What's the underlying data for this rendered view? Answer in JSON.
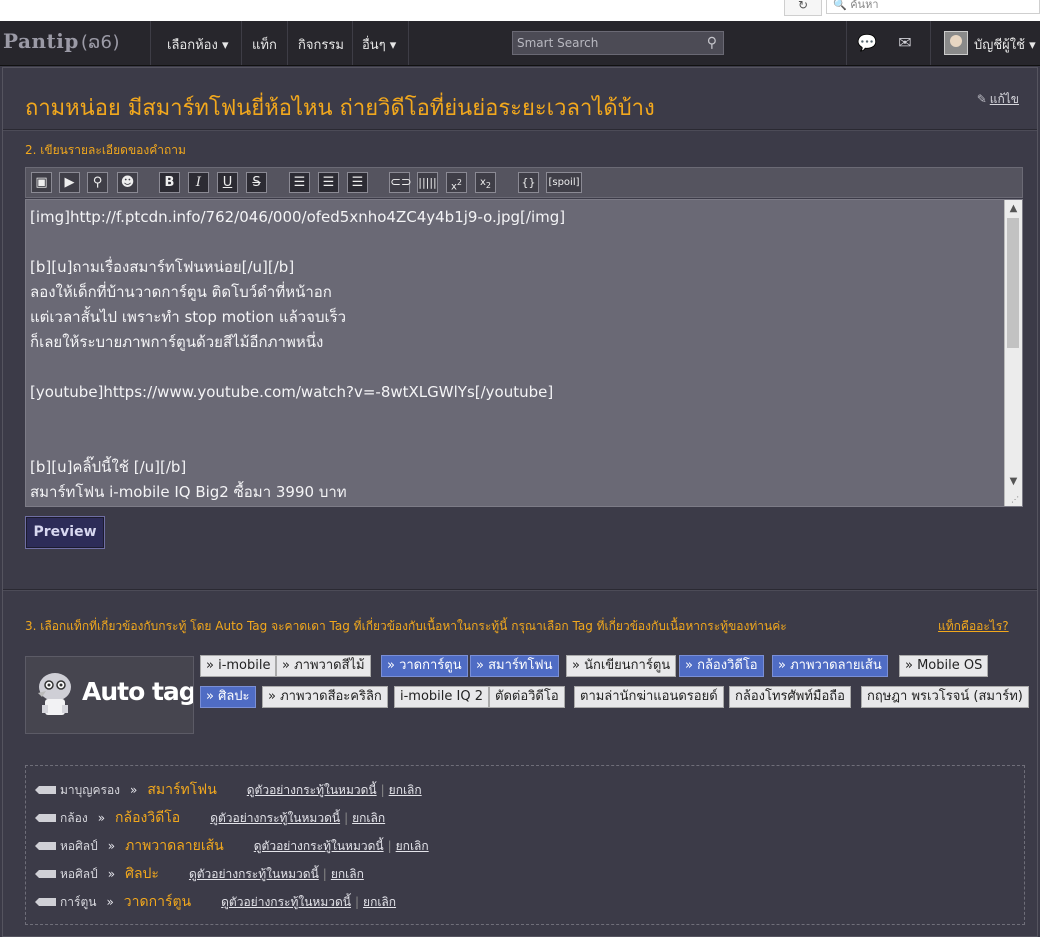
{
  "browser": {
    "search_placeholder": "ค้นหา",
    "refresh": "↻"
  },
  "navbar": {
    "logo_main": "Pantip",
    "logo_sub": "(ລ6)",
    "items": [
      "เลือกห้อง ▾",
      "แท็ก",
      "กิจกรรม",
      "อื่นๆ ▾"
    ],
    "search_placeholder": "Smart Search",
    "account": "บัญชีผู้ใช้ ▾"
  },
  "post": {
    "title": "ถามหน่อย มีสมาร์ทโฟนยี่ห้อไหน ถ่ายวิดีโอที่ย่นย่อระยะเวลาได้บ้าง",
    "edit": "แก้ไข"
  },
  "section2": {
    "heading": "2. เขียนรายละเอียดของคำถาม",
    "toolbar": {
      "bold": "B",
      "italic": "I",
      "underline": "U",
      "strike": "S",
      "superscript": "x2",
      "subscript": "x2",
      "code": "{}",
      "spoil": "[spoil]"
    },
    "editor_lines": [
      "[img]http://f.ptcdn.info/762/046/000/ofed5xnho4ZC4y4b1j9-o.jpg[/img]",
      "",
      "[b][u]ถามเรื่องสมาร์ทโฟนหน่อย[/u][/b]",
      "ลองให้เด็กที่บ้านวาดการ์ตูน ติดโบว์ดำที่หน้าอก",
      "แต่เวลาสั้นไป เพราะทำ stop motion แล้วจบเร็ว",
      "ก็เลยให้ระบายภาพการ์ตูนด้วยสีไม้อีกภาพหนึ่ง",
      "",
      "[youtube]https://www.youtube.com/watch?v=-8wtXLGWlYs[/youtube]",
      "",
      "",
      "[b][u]คลิ๊ปนี้ใช้ [/u][/b]",
      "สมาร์ทโฟน i-mobile IQ Big2 ซื้อมา 3990 บาท"
    ],
    "preview": "Preview"
  },
  "section3": {
    "heading": "3. เลือกแท็กที่เกี่ยวข้องกับกระทู้ โดย Auto Tag จะคาดเดา Tag ที่เกี่ยวข้องกับเนื้อหาในกระทู้นี้ กรุณาเลือก Tag ที่เกี่ยวข้องกับเนื้อหากระทู้ของท่านค่ะ",
    "what_is_tag": "แท็กคืออะไร?",
    "autotag_label": "Auto tag",
    "tags_row1": [
      {
        "label": "» i-mobile",
        "selected": false
      },
      {
        "label": "» ภาพวาดสีไม้",
        "selected": false
      },
      {
        "label": "» วาดการ์ตูน",
        "selected": true
      },
      {
        "label": "» สมาร์ทโฟน",
        "selected": true
      },
      {
        "label": "» นักเขียนการ์ตูน",
        "selected": false
      },
      {
        "label": "» กล้องวิดีโอ",
        "selected": true
      },
      {
        "label": "» ภาพวาดลายเส้น",
        "selected": true
      },
      {
        "label": "» Mobile OS",
        "selected": false
      }
    ],
    "tags_row2": [
      {
        "label": "» ศิลปะ",
        "selected": true
      },
      {
        "label": "» ภาพวาดสีอะคริลิก",
        "selected": false
      },
      {
        "label": "i-mobile IQ 2",
        "selected": false
      },
      {
        "label": "ตัดต่อวิดีโอ",
        "selected": false
      },
      {
        "label": "ตามล่านักฆ่าแอนดรอยด์",
        "selected": false
      },
      {
        "label": "กล้องโทรศัพท์มือถือ",
        "selected": false
      },
      {
        "label": "กฤษฎา พรเวโรจน์ (สมาร์ท)",
        "selected": false
      }
    ],
    "selected": [
      {
        "room": "มาบุญครอง",
        "tag": "สมาร์ทโฟน"
      },
      {
        "room": "กล้อง",
        "tag": "กล้องวิดีโอ"
      },
      {
        "room": "หอศิลป์",
        "tag": "ภาพวาดลายเส้น"
      },
      {
        "room": "หอศิลป์",
        "tag": "ศิลปะ"
      },
      {
        "room": "การ์ตูน",
        "tag": "วาดการ์ตูน"
      }
    ],
    "view_examples": "ดูตัวอย่างกระทู้ในหมวดนี้",
    "cancel": "ยกเลิก",
    "arrow": "»"
  }
}
